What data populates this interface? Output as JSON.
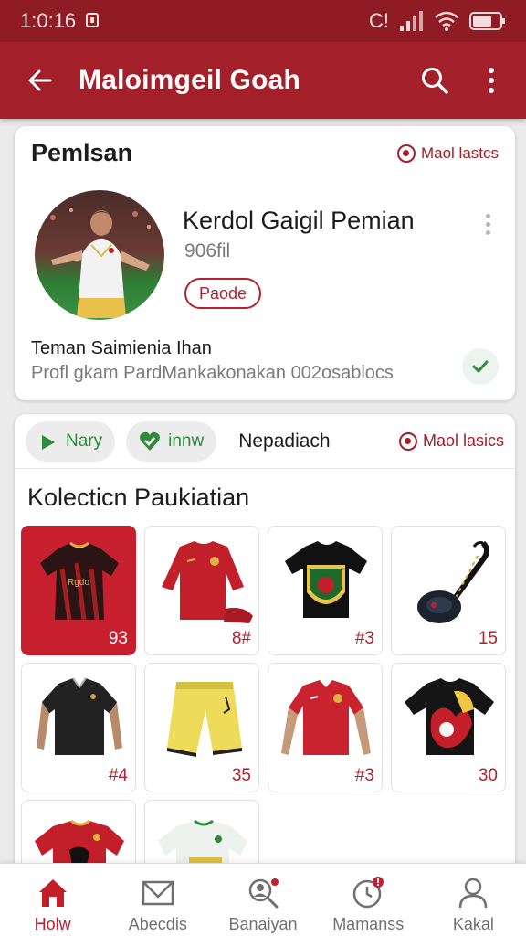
{
  "status_bar": {
    "time": "1:0:16",
    "signal_text": "C!"
  },
  "app_bar": {
    "title": "Maloimgeil Goah"
  },
  "profile_card": {
    "section_title": "Pemlsan",
    "link_label": "Maol lastcs",
    "player_name": "Kerdol Gaigil Pemian",
    "player_sub": "906fil",
    "pill_label": "Paode",
    "team_name": "Teman Saimienia Ihan",
    "team_desc": "Profl gkam PardMankakonakan 002osablocs"
  },
  "collection": {
    "tabs": [
      {
        "label": "Nary"
      },
      {
        "label": "innw"
      },
      {
        "label": "Nepadiach"
      }
    ],
    "link_label": "Maol lasics",
    "title": "Kolecticn Paukiatian",
    "items": [
      {
        "kind": "jersey-dark-red",
        "number": "93",
        "selected": true
      },
      {
        "kind": "jersey-red-longsleeve",
        "number": "8#"
      },
      {
        "kind": "jersey-crest",
        "number": "#3"
      },
      {
        "kind": "scarf-badge",
        "number": "15"
      },
      {
        "kind": "polo-black",
        "number": "#4"
      },
      {
        "kind": "shorts-yellow",
        "number": "35"
      },
      {
        "kind": "shirt-red",
        "number": "#3"
      },
      {
        "kind": "tee-graphic",
        "number": "30"
      },
      {
        "kind": "jersey-red-partial",
        "number": ""
      },
      {
        "kind": "jersey-white-partial",
        "number": ""
      }
    ]
  },
  "bottom_nav": [
    {
      "label": "Holw",
      "icon": "home-icon",
      "active": true
    },
    {
      "label": "Abecdis",
      "icon": "mail-icon"
    },
    {
      "label": "Banaiyan",
      "icon": "search-person-icon"
    },
    {
      "label": "Mamanss",
      "icon": "clock-badge-icon"
    },
    {
      "label": "Kakal",
      "icon": "profile-icon"
    }
  ],
  "colors": {
    "primary": "#a31f2a",
    "status_bar": "#8f1b25",
    "accent_green": "#2e8b3c"
  }
}
